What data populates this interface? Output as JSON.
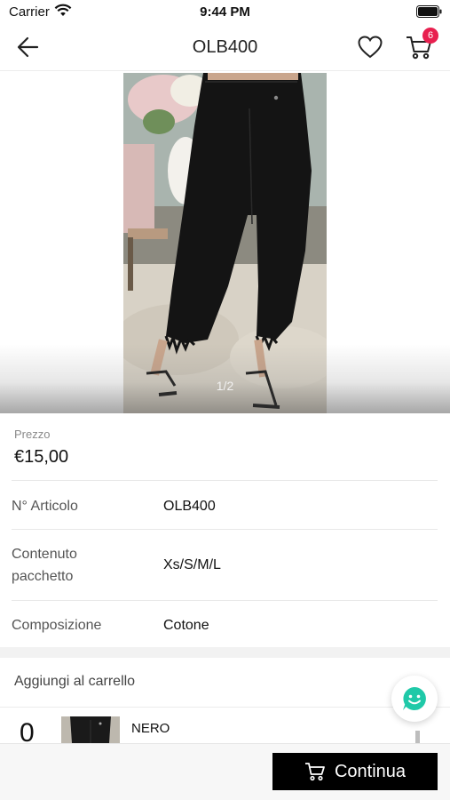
{
  "status_bar": {
    "carrier": "Carrier",
    "time": "9:44 PM"
  },
  "nav": {
    "title": "OLB400",
    "cart_count": "6"
  },
  "gallery": {
    "page_indicator": "1/2"
  },
  "price": {
    "label": "Prezzo",
    "value": "€15,00"
  },
  "specs": [
    {
      "label": "N° Articolo",
      "value": "OLB400"
    },
    {
      "label": "Contenuto pacchetto",
      "label_line1": "Contenuto",
      "label_line2": "pacchetto",
      "value": "Xs/S/M/L"
    },
    {
      "label": "Composizione",
      "value": "Cotone"
    }
  ],
  "add_to_cart": {
    "title": "Aggiungi al carrello",
    "quantity": "0",
    "variant_name": "NERO"
  },
  "bottom_bar": {
    "continue_label": "Continua"
  },
  "colors": {
    "accent": "#000000",
    "badge": "#e8204f",
    "chat": "#1fc9a8"
  }
}
